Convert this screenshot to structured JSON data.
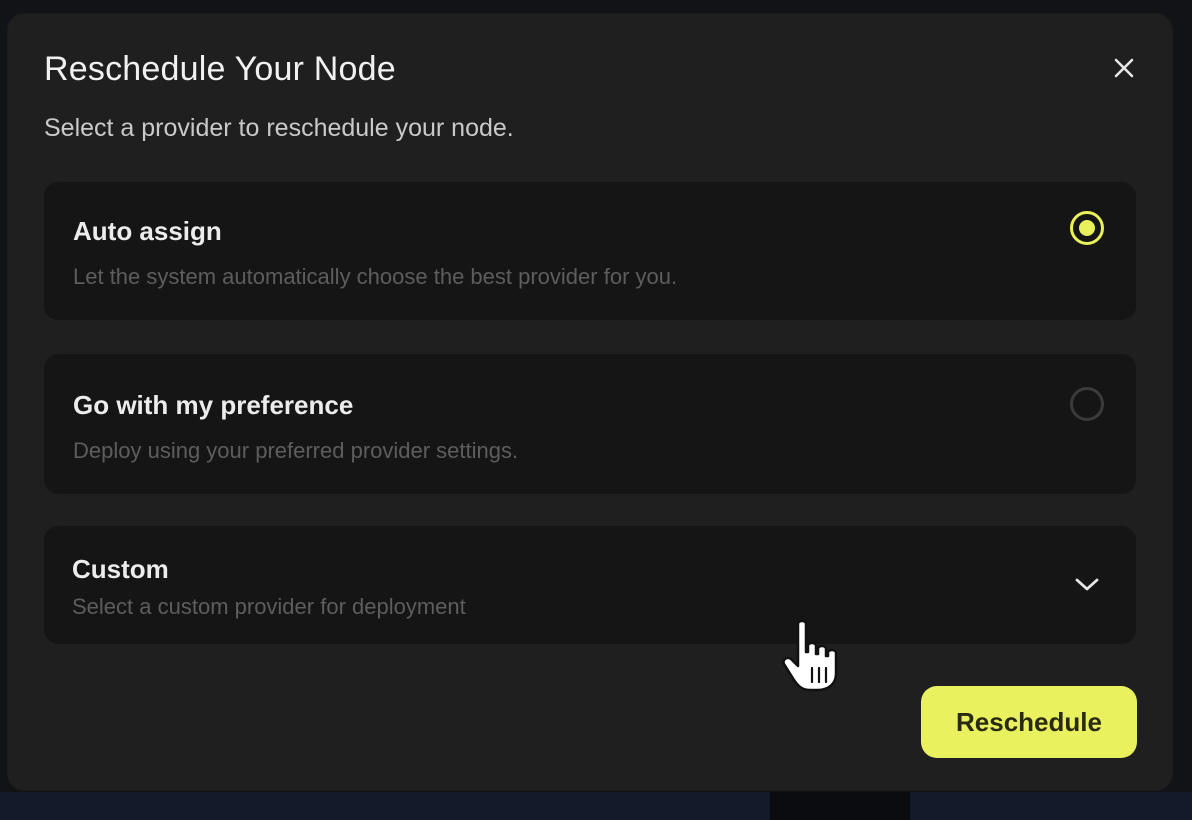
{
  "dialog": {
    "title": "Reschedule Your Node",
    "subtitle": "Select a provider to reschedule your node.",
    "close_icon": "close-icon"
  },
  "options": [
    {
      "title": "Auto assign",
      "description": "Let the system automatically choose the best provider for you.",
      "selected": true
    },
    {
      "title": "Go with my preference",
      "description": "Deploy using your preferred provider settings.",
      "selected": false
    },
    {
      "title": "Custom",
      "description": "Select a custom provider for deployment",
      "expand_icon": "chevron-down-icon"
    }
  ],
  "actions": {
    "reschedule_label": "Reschedule"
  },
  "colors": {
    "accent": "#e9f15e",
    "dialog_bg": "#1f1f1f",
    "card_bg": "#151515"
  }
}
